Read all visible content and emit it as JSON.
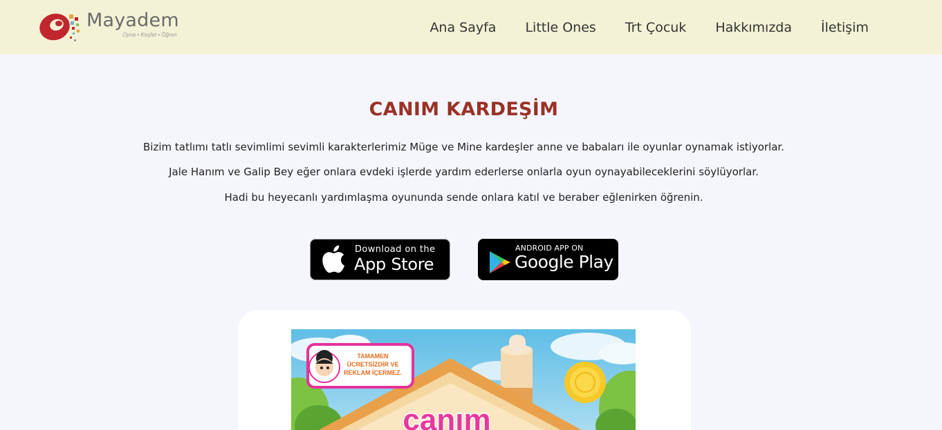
{
  "brand": {
    "name": "Mayadem",
    "tagline": "Oyna • Keşfet • Öğren"
  },
  "nav": {
    "items": [
      {
        "label": "Ana Sayfa"
      },
      {
        "label": "Little Ones"
      },
      {
        "label": "Trt Çocuk"
      },
      {
        "label": "Hakkımızda"
      },
      {
        "label": "İletişim"
      }
    ]
  },
  "main": {
    "title": "CANIM KARDEŞİM",
    "paragraphs": [
      "Bizim tatlımı tatlı sevimlimi sevimli karakterlerimiz Müge ve Mine kardeşler anne ve babaları ile oyunlar oynamak istiyorlar.",
      "Jale Hanım ve Galip Bey eğer onlara evdeki işlerde yardım ederlerse onlarla oyun oynayabileceklerini söylüyorlar.",
      "Hadi bu heyecanlı yardımlaşma oyununda sende onlara katıl ve beraber eğlenirken öğrenin."
    ]
  },
  "stores": {
    "appstore": {
      "small": "Download on the",
      "big": "App Store"
    },
    "googleplay": {
      "small": "ANDROID APP ON",
      "big": "Google Play"
    }
  },
  "game_image": {
    "badge_line1": "TAMAMEN",
    "badge_line2": "ÜCRETSİZDİR VE",
    "badge_line3": "REKLAM İÇERMEZ.",
    "logo_text": "canım"
  },
  "colors": {
    "header_bg": "#f4f2d6",
    "page_bg": "#f5f6fc",
    "title": "#9a3125"
  },
  "icons": [
    "apple-icon",
    "google-play-icon"
  ]
}
